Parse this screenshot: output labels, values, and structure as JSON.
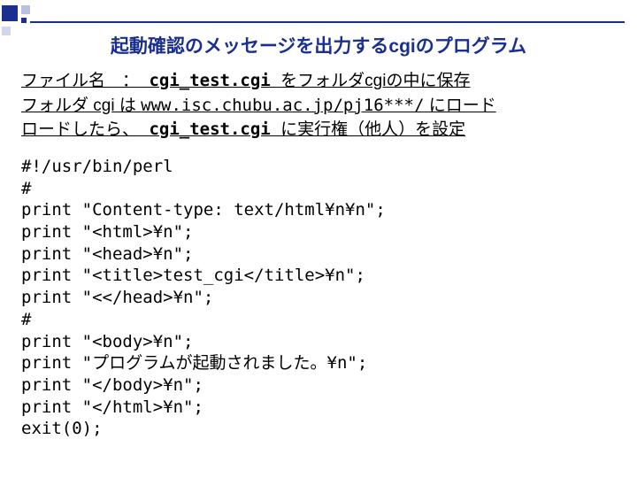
{
  "title": "起動確認のメッセージを出力するcgiのプログラム",
  "intro": {
    "line1_pre": "ファイル名　：",
    "line1_file": " cgi_test.cgi ",
    "line1_post": "をフォルダcgiの中に保存",
    "line2_pre": "フォルダ cgi は ",
    "line2_url": "www.isc.chubu.ac.jp/pj16***/",
    "line2_post": " にロード",
    "line3_pre": "ロードしたら、",
    "line3_file": " cgi_test.cgi ",
    "line3_post": "に実行権（他人）を設定"
  },
  "code": [
    "#!/usr/bin/perl",
    "#",
    "print \"Content-type: text/html¥n¥n\";",
    "print \"<html>¥n\";",
    "print \"<head>¥n\";",
    "print \"<title>test_cgi</title>¥n\";",
    "print \"<</head>¥n\";",
    "#",
    "print \"<body>¥n\";",
    "print \"プログラムが起動されました。¥n\";",
    "print \"</body>¥n\";",
    "print \"</html>¥n\";",
    "exit(0);"
  ]
}
